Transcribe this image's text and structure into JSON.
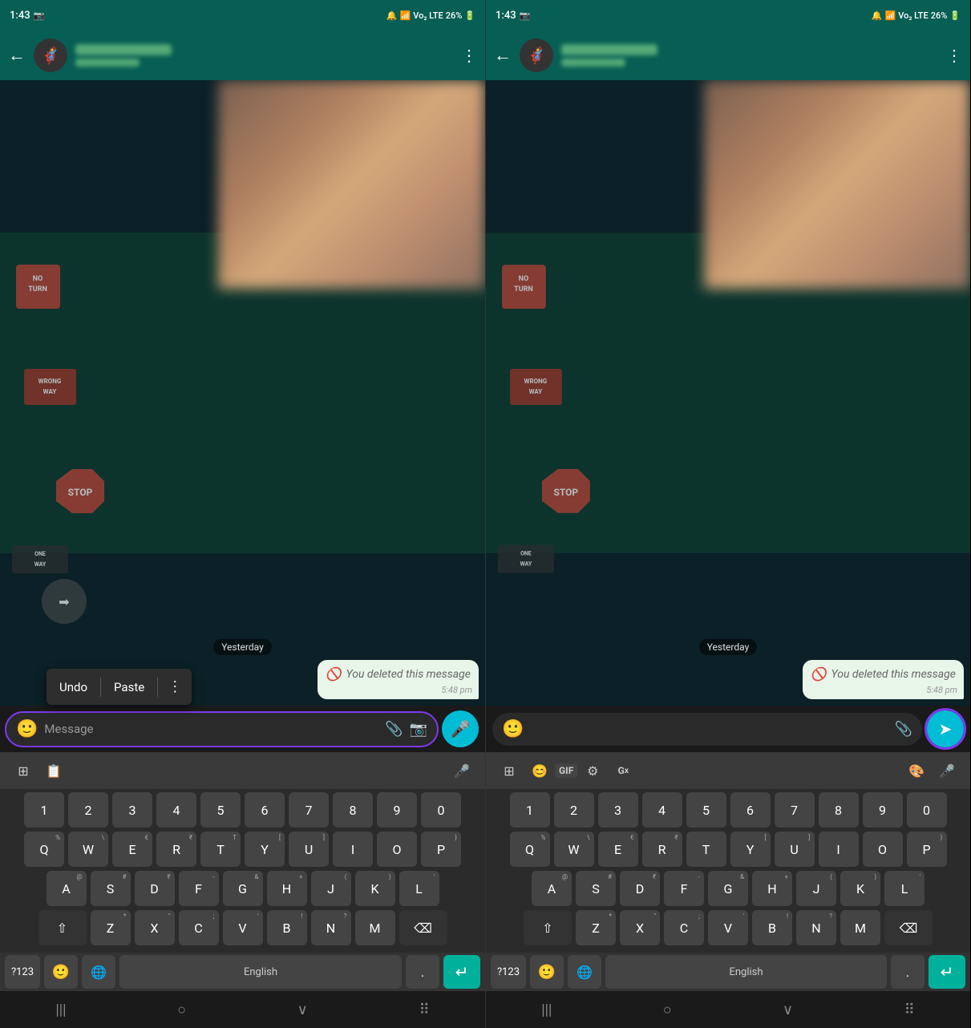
{
  "panel1": {
    "status": {
      "time": "1:43",
      "battery": "26%",
      "signal": "Vo₂ LTE"
    },
    "appbar": {
      "back_label": "←",
      "more_label": "⋮",
      "avatar_emoji": "🦸"
    },
    "chat": {
      "date_badge": "Yesterday",
      "deleted_message": "You deleted this message",
      "message_time": "5:48 pm"
    },
    "context_menu": {
      "undo": "Undo",
      "paste": "Paste",
      "more": "⋮"
    },
    "input": {
      "placeholder": "Message",
      "emoji_icon": "🙂",
      "attach_icon": "📎",
      "camera_icon": "📷"
    },
    "keyboard": {
      "toolbar": {
        "grid_icon": "…",
        "clipboard_icon": "📋",
        "mic_icon": "🎤"
      },
      "rows": [
        [
          "1",
          "2",
          "3",
          "4",
          "5",
          "6",
          "7",
          "8",
          "9",
          "0"
        ],
        [
          "Q",
          "W",
          "E",
          "R",
          "T",
          "Y",
          "U",
          "I",
          "O",
          "P"
        ],
        [
          "A",
          "S",
          "D",
          "F",
          "G",
          "H",
          "J",
          "K",
          "L"
        ],
        [
          "⇧",
          "Z",
          "X",
          "C",
          "V",
          "B",
          "N",
          "M",
          "⌫"
        ]
      ],
      "bottom": {
        "num": "?123",
        "emoji": "🙂",
        "globe": "🌐",
        "space": "English",
        "period": ".",
        "enter": "↵"
      }
    },
    "navbar": {
      "back": "│││",
      "home": "○",
      "recents": "∨",
      "keyboard": "▦"
    }
  },
  "panel2": {
    "status": {
      "time": "1:43",
      "battery": "26%"
    },
    "appbar": {
      "back_label": "←",
      "more_label": "⋮",
      "avatar_emoji": "🦸"
    },
    "chat": {
      "date_badge": "Yesterday",
      "deleted_message": "You deleted this message",
      "message_time": "5:48 pm"
    },
    "input": {
      "emoji_icon": "🙂",
      "attach_icon": "📎"
    },
    "send_btn": "➤",
    "keyboard": {
      "toolbar": {
        "grid_icon": "⊞",
        "sticker_icon": "🙂",
        "gif_text": "GIF",
        "settings_icon": "⚙",
        "translate_icon": "Gₓ",
        "palette_icon": "🎨",
        "mic_icon": "🎤"
      },
      "rows": [
        [
          "1",
          "2",
          "3",
          "4",
          "5",
          "6",
          "7",
          "8",
          "9",
          "0"
        ],
        [
          "Q",
          "W",
          "E",
          "R",
          "T",
          "Y",
          "U",
          "I",
          "O",
          "P"
        ],
        [
          "A",
          "S",
          "D",
          "F",
          "G",
          "H",
          "J",
          "K",
          "L"
        ],
        [
          "⇧",
          "Z",
          "X",
          "C",
          "V",
          "B",
          "N",
          "M",
          "⌫"
        ]
      ],
      "bottom": {
        "num": "?123",
        "emoji": "🙂",
        "globe": "🌐",
        "space": "English",
        "period": ".",
        "enter": "↵"
      }
    },
    "navbar": {
      "back": "│││",
      "home": "○",
      "recents": "∨",
      "keyboard": "▦"
    }
  }
}
